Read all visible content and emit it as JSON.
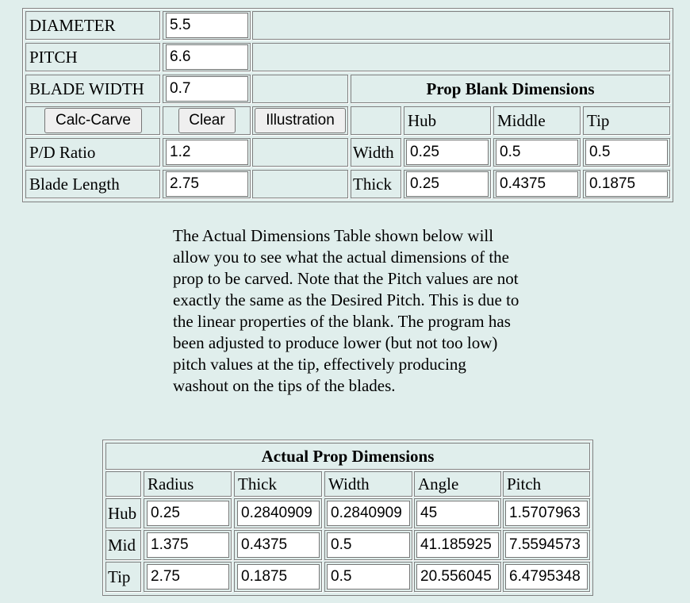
{
  "inputs": {
    "labels": {
      "diameter": "DIAMETER",
      "pitch": "PITCH",
      "blade_width": "BLADE WIDTH",
      "pd_ratio": "P/D Ratio",
      "blade_length": "Blade Length"
    },
    "values": {
      "diameter": "5.5",
      "pitch": "6.6",
      "blade_width": "0.7",
      "pd_ratio": "1.2",
      "blade_length": "2.75"
    }
  },
  "buttons": {
    "calc": "Calc-Carve",
    "clear": "Clear",
    "illustration": "Illustration"
  },
  "blank": {
    "title": "Prop Blank Dimensions",
    "columns": [
      "Hub",
      "Middle",
      "Tip"
    ],
    "width_label": "Width",
    "thick_label": "Thick",
    "width": [
      "0.25",
      "0.5",
      "0.5"
    ],
    "thick": [
      "0.25",
      "0.4375",
      "0.1875"
    ]
  },
  "description": "The Actual Dimensions Table shown below will allow you to see what the actual dimensions of the prop to be carved. Note that the Pitch values are not exactly the same as the Desired Pitch. This is due to the linear properties of the blank. The program has been adjusted to produce lower (but not too low) pitch values at the tip, effectively producing washout on the tips of the blades.",
  "actual": {
    "title": "Actual Prop Dimensions",
    "headers": [
      "Radius",
      "Thick",
      "Width",
      "Angle",
      "Pitch"
    ],
    "rows": [
      {
        "label": "Hub",
        "values": [
          "0.25",
          "0.2840909",
          "0.2840909",
          "45",
          "1.5707963"
        ]
      },
      {
        "label": "Mid",
        "values": [
          "1.375",
          "0.4375",
          "0.5",
          "41.185925",
          "7.5594573"
        ]
      },
      {
        "label": "Tip",
        "values": [
          "2.75",
          "0.1875",
          "0.5",
          "20.556045",
          "6.4795348"
        ]
      }
    ]
  },
  "colors": {
    "background": "#e0eeec"
  }
}
